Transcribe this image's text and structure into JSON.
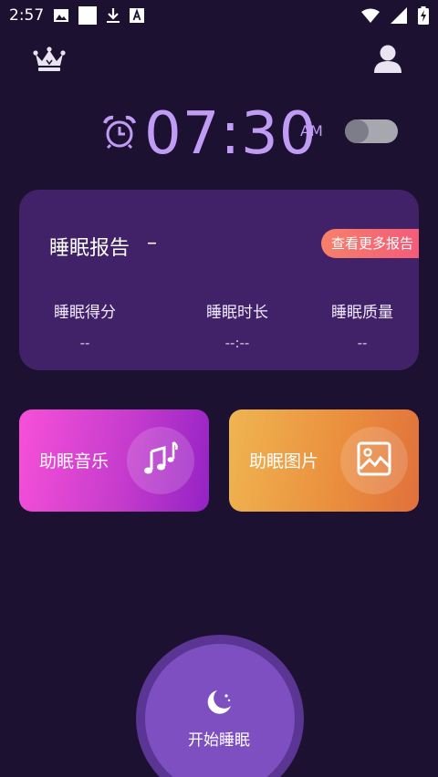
{
  "status_bar": {
    "time": "2:57",
    "left_icons": [
      "image-icon",
      "square-icon",
      "download-icon",
      "font-a-icon"
    ],
    "right_icons": [
      "wifi-icon",
      "signal-icon",
      "battery-charging-icon"
    ]
  },
  "header": {
    "left_icon": "crown-icon",
    "right_icon": "profile-icon"
  },
  "alarm": {
    "time": "07:30",
    "ampm": "AM",
    "enabled": false,
    "accent_color": "#c09cf5"
  },
  "report": {
    "title": "睡眠报告",
    "dash": "--",
    "more_label": "查看更多报告",
    "metrics": [
      {
        "label": "睡眠得分",
        "value": "--"
      },
      {
        "label": "睡眠时长",
        "value": "--:--"
      },
      {
        "label": "睡眠质量",
        "value": "--"
      }
    ]
  },
  "tiles": [
    {
      "label": "助眠音乐",
      "icon": "music-notes-icon"
    },
    {
      "label": "助眠图片",
      "icon": "image-icon"
    }
  ],
  "start_button": {
    "label": "开始睡眠",
    "icon": "moon-icon"
  },
  "colors": {
    "background": "#1d1132",
    "card": "#412167",
    "more_button_gradient": [
      "#f6806a",
      "#f3577b"
    ],
    "music_gradient": [
      "#f750d8",
      "#9422c5"
    ],
    "photo_gradient": [
      "#f0b551",
      "#e0703c"
    ],
    "start_button": "#7d4fc0"
  }
}
